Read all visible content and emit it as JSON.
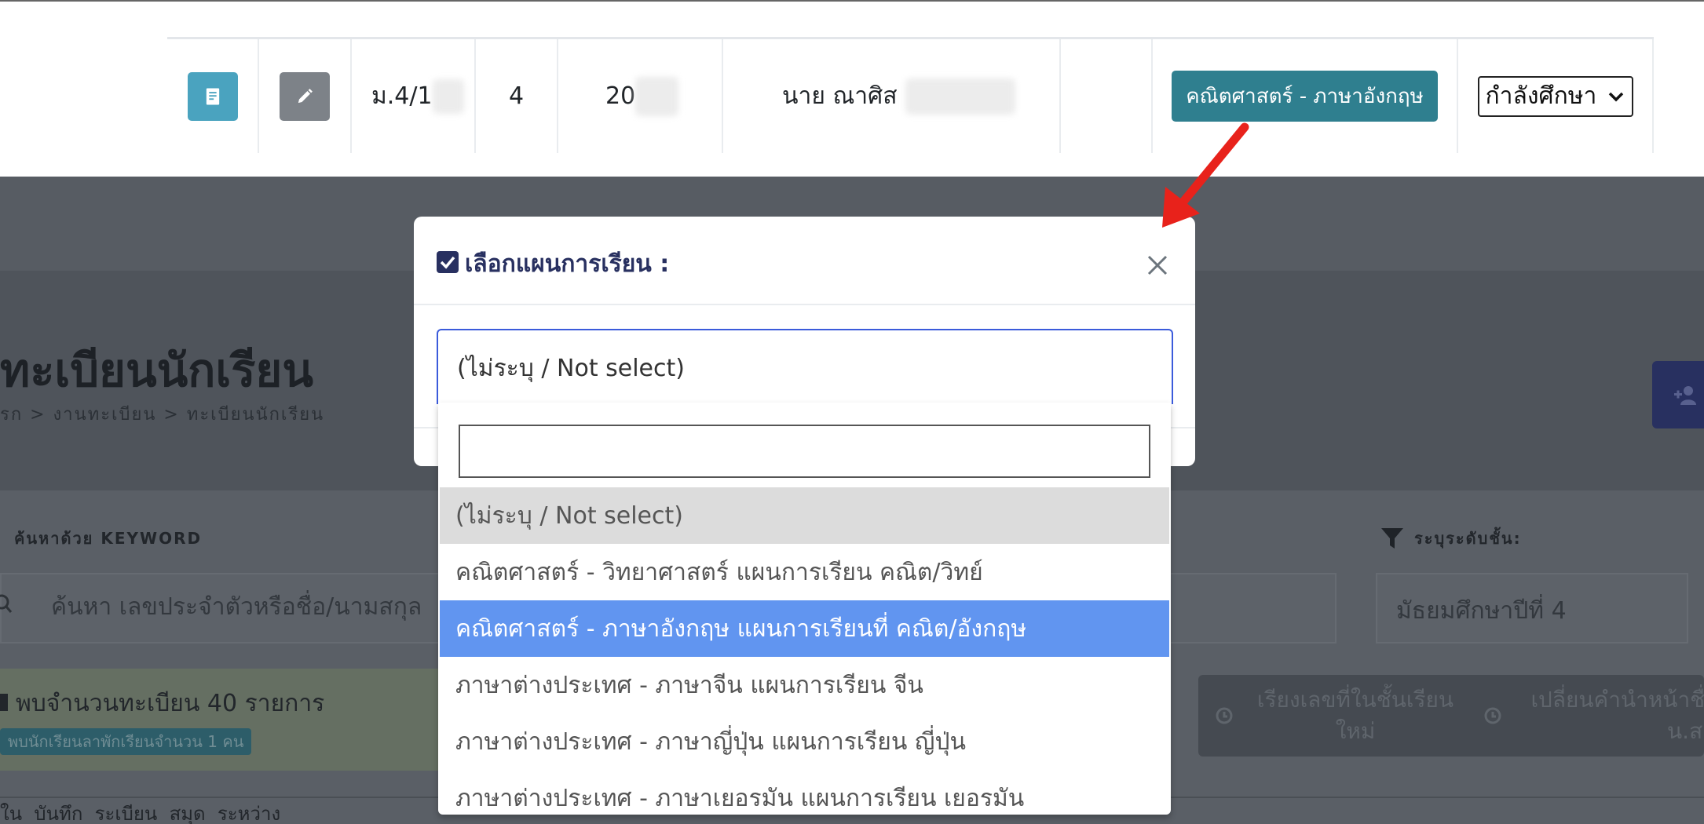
{
  "row": {
    "class": "ม.4/1",
    "number": "4",
    "student_id": "20",
    "name": "นาย ณาศิส",
    "plan_badge": "คณิตศาสตร์ - ภาษาอังกฤษ",
    "status": "กำลังศึกษา"
  },
  "background": {
    "title": "ทะเบียนนักเรียน",
    "breadcrumb": "รก > งานทะเบียน > ทะเบียนนักเรียน",
    "keyword_label": "ค้นหาด้วย KEYWORD",
    "search_placeholder": "ค้นหา เลขประจำตัวหรือชื่อ/นามสกุล",
    "level_label": "ระบุระดับชั้น:",
    "level_value": "มัธยมศึกษาปีที่ 4",
    "alert_text": "พบจำนวนทะเบียน 40 รายการ",
    "alert_badge": "พบนักเรียนลาพักเรียนจำนวน 1 คน",
    "btn_reorder": "เรียงเลขที่ในชั้นเรียนใหม่",
    "btn_prefix": "เปลี่ยนคำนำหน้าชื่อ น.ส.)",
    "table_head": "ใน  บันทึก  ระเบียน  สมุด  ระหว่าง"
  },
  "modal": {
    "title": "เลือกแผนการเรียน :",
    "selected": "(ไม่ระบุ / Not select)"
  },
  "dropdown": {
    "search_value": "",
    "options": [
      "(ไม่ระบุ / Not select)",
      "คณิตศาสตร์ - วิทยาศาสตร์ แผนการเรียน คณิต/วิทย์",
      "คณิตศาสตร์ - ภาษาอังกฤษ แผนการเรียนที่ คณิต/อังกฤษ",
      "ภาษาต่างประเทศ - ภาษาจีน แผนการเรียน จีน",
      "ภาษาต่างประเทศ - ภาษาญี่ปุ่น แผนการเรียน ญี่ปุ่น",
      "ภาษาต่างประเทศ - ภาษาเยอรมัน แผนการเรียน เยอรมัน"
    ]
  },
  "colors": {
    "info_btn": "#4aa3bf",
    "edit_btn": "#7d8288",
    "badge": "#2f7f8f",
    "highlight": "#6195f0",
    "arrow": "#e8221b"
  }
}
